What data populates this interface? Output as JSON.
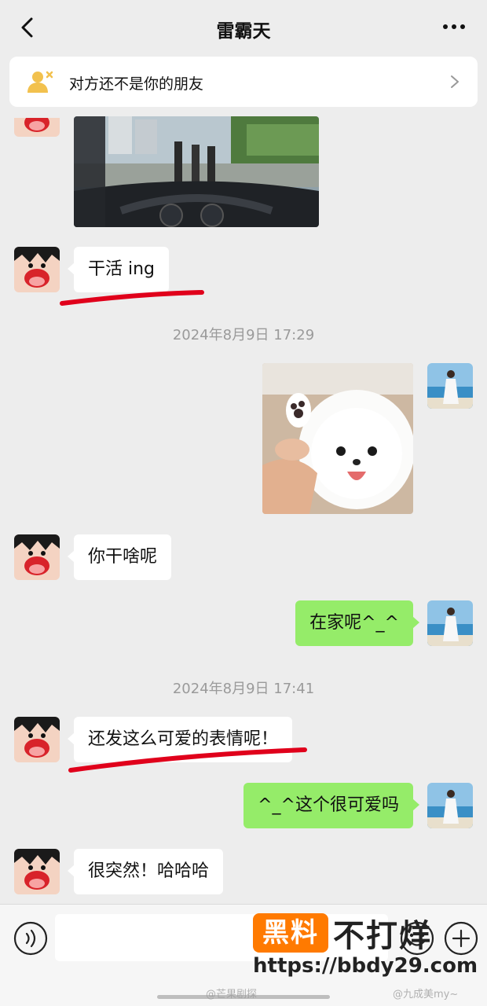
{
  "header": {
    "title": "雷霸天"
  },
  "notice": {
    "text": "对方还不是你的朋友"
  },
  "messages": [
    {
      "side": "left",
      "type": "image",
      "content": "car-windshield-photo"
    },
    {
      "side": "left",
      "type": "text",
      "text": "干活 ing"
    },
    {
      "type": "time",
      "text": "2024年8月9日 17:29"
    },
    {
      "side": "right",
      "type": "image",
      "content": "pomeranian-puppy-sticker"
    },
    {
      "side": "left",
      "type": "text",
      "text": "你干啥呢"
    },
    {
      "side": "right",
      "type": "text",
      "text": "在家呢^_^"
    },
    {
      "type": "time",
      "text": "2024年8月9日 17:41"
    },
    {
      "side": "left",
      "type": "text",
      "text": "还发这么可爱的表情呢！"
    },
    {
      "side": "right",
      "type": "text",
      "text": "^_^这个很可爱吗"
    },
    {
      "side": "left",
      "type": "text",
      "text": "很突然！哈哈哈"
    }
  ],
  "watermark": {
    "badge": "黑料",
    "name": "不打烊",
    "url": "https://bbdy29.com"
  },
  "credits": {
    "left": "@芒果剧探",
    "right": "@九成美my~"
  },
  "colors": {
    "background": "#ededed",
    "sent_bubble": "#95ec69",
    "received_bubble": "#ffffff",
    "annotation": "#e0001b",
    "watermark_badge": "#ff7a00"
  }
}
